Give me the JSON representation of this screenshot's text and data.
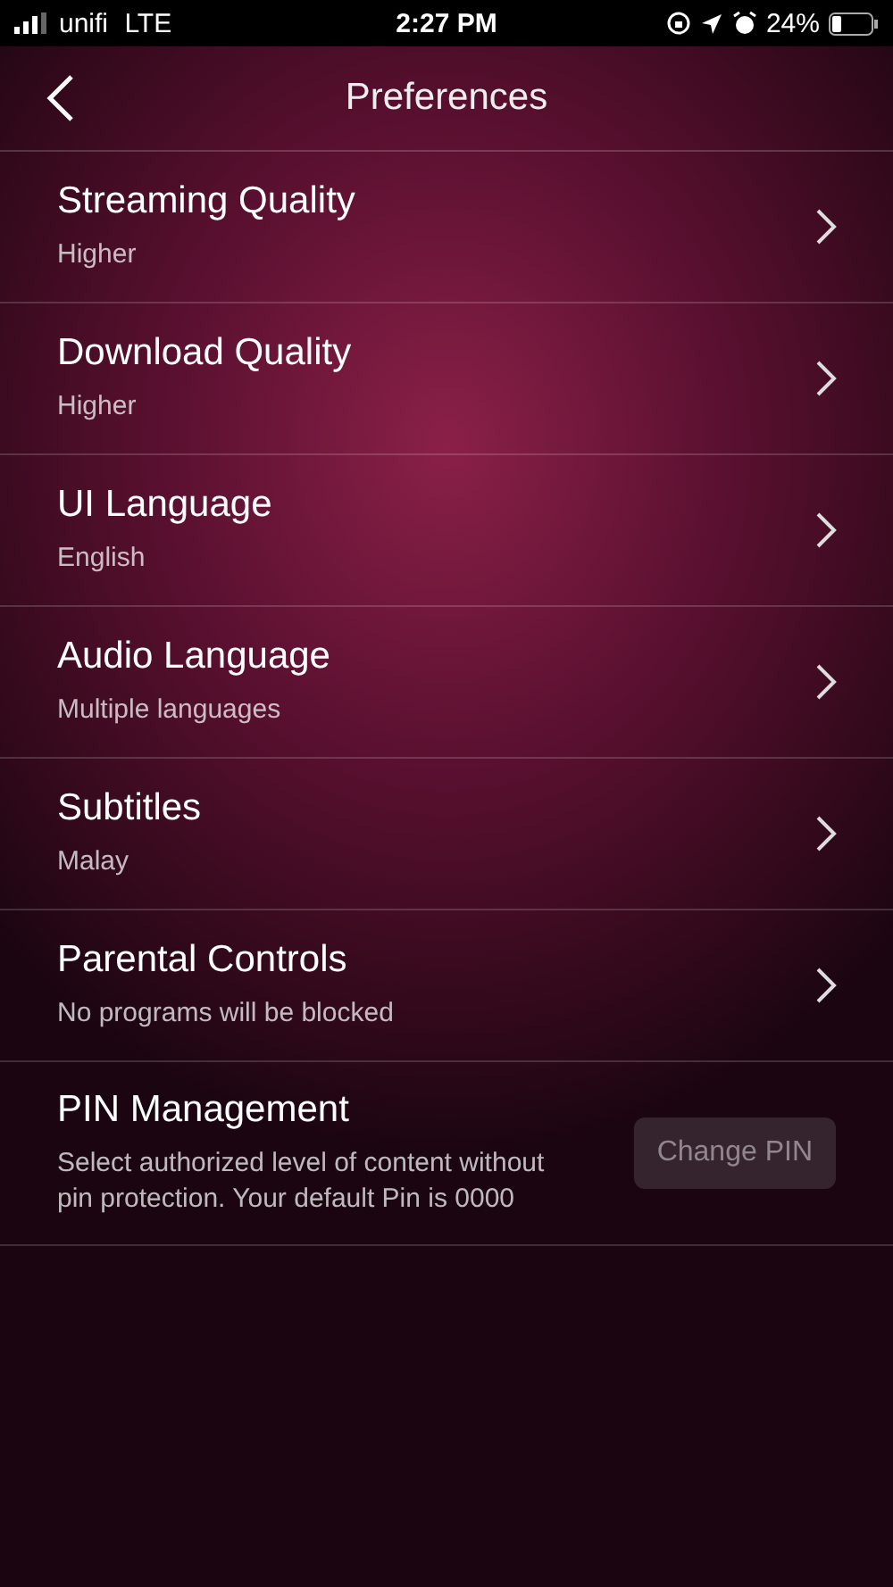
{
  "status_bar": {
    "carrier": "unifi",
    "network": "LTE",
    "time": "2:27 PM",
    "battery": "24%"
  },
  "header": {
    "title": "Preferences"
  },
  "settings": [
    {
      "kind": "link",
      "title": "Streaming Quality",
      "value": "Higher"
    },
    {
      "kind": "link",
      "title": "Download Quality",
      "value": "Higher"
    },
    {
      "kind": "link",
      "title": "UI Language",
      "value": "English"
    },
    {
      "kind": "link",
      "title": "Audio Language",
      "value": "Multiple languages"
    },
    {
      "kind": "link",
      "title": "Subtitles",
      "value": "Malay"
    },
    {
      "kind": "link",
      "title": "Parental Controls",
      "value": "No programs will be blocked"
    },
    {
      "kind": "action",
      "title": "PIN Management",
      "value": "Select authorized level of content without pin protection. Your default Pin is 0000",
      "button": {
        "label": "Change PIN",
        "disabled": true
      }
    }
  ]
}
